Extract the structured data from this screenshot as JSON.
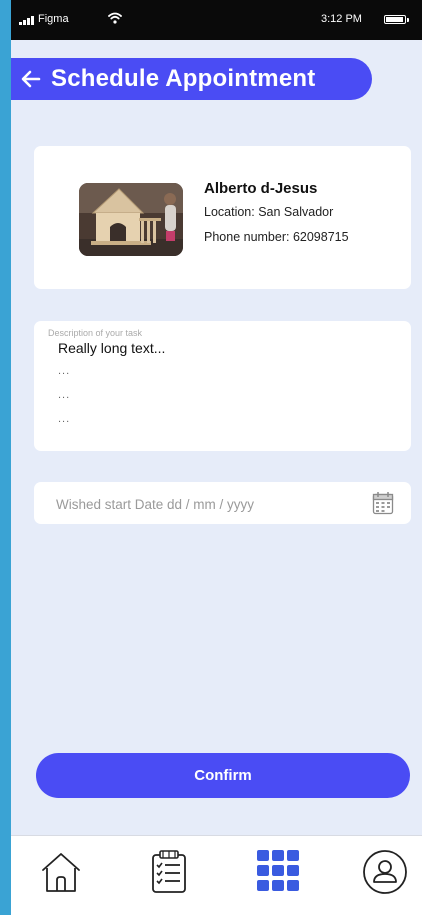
{
  "status_bar": {
    "carrier": "Figma",
    "time": "3:12 PM",
    "icons": [
      "signal-icon",
      "wifi-icon",
      "battery-icon"
    ]
  },
  "header": {
    "title": "Schedule Appointment",
    "back_icon": "arrow-left-icon"
  },
  "professional": {
    "name": "Alberto d-Jesus",
    "location": "Location: San Salvador",
    "phone": "Phone number: 62098715"
  },
  "description": {
    "label": "Description of your task",
    "text": "Really long text...",
    "continuation": [
      "...",
      "...",
      "..."
    ]
  },
  "date_field": {
    "placeholder": "Wished start Date dd / mm / yyyy",
    "icon": "calendar-icon"
  },
  "confirm": {
    "label": "Confirm"
  },
  "bottom_nav": {
    "items": [
      "home-icon",
      "checklist-icon",
      "grid-icon",
      "profile-icon"
    ]
  },
  "colors": {
    "accent": "#4a4cf4",
    "background": "#e6ecf9",
    "frame": "#3aa3d4",
    "status_bar": "#0a0a0a",
    "nav_icon": "#3a5be0"
  }
}
